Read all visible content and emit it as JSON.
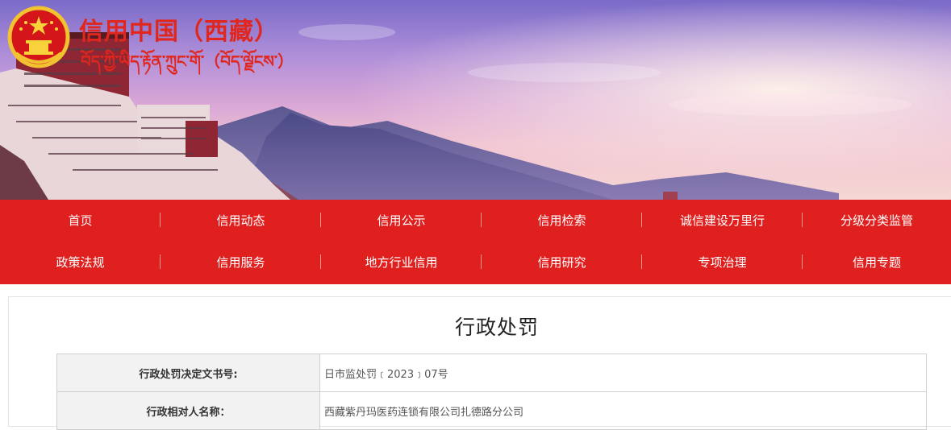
{
  "header": {
    "title": "信用中国（西藏）",
    "subtitle": "བོད་ཀྱི་ཡིད་རྟོན་ཀྲུང་གོ་（བོད་ལྗོངས་）",
    "emblem_icon": "national-emblem-icon"
  },
  "nav": {
    "row1": [
      "首页",
      "信用动态",
      "信用公示",
      "信用检索",
      "诚信建设万里行",
      "分级分类监管"
    ],
    "row2": [
      "政策法规",
      "信用服务",
      "地方行业信用",
      "信用研究",
      "专项治理",
      "信用专题"
    ]
  },
  "page": {
    "title": "行政处罚",
    "rows": [
      {
        "label": "行政处罚决定文书号:",
        "value": "日市监处罚﹝2023﹞07号"
      },
      {
        "label": "行政相对人名称：",
        "value": "西藏紫丹玛医药连锁有限公司扎德路分公司"
      }
    ]
  },
  "colors": {
    "brand_red": "#e0201f",
    "title_red": "#e0261d",
    "table_label_bg": "#f2f2f2"
  }
}
